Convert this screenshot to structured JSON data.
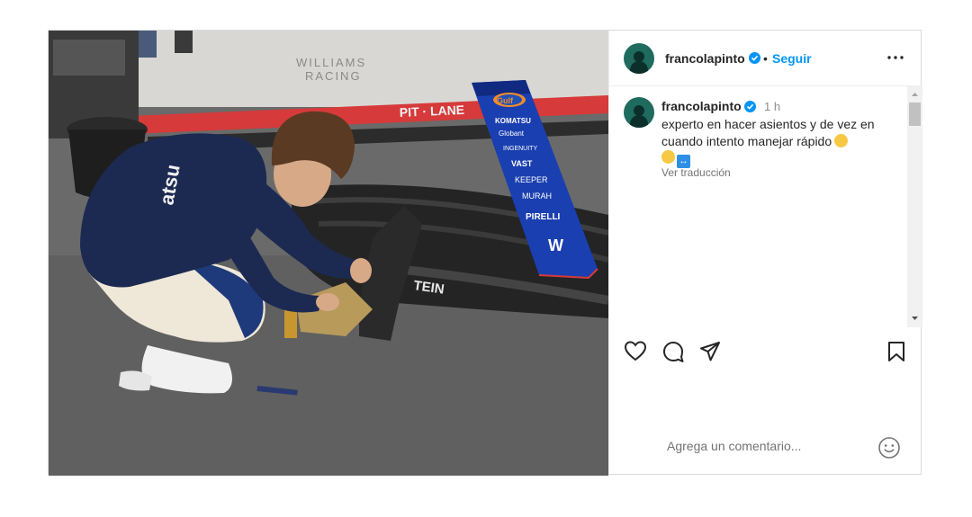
{
  "header": {
    "username": "francolapinto",
    "separator": "•",
    "follow_label": "Seguir"
  },
  "caption": {
    "username": "francolapinto",
    "time": "1 h",
    "text": "experto en hacer asientos y de vez en cuando intento manejar rápido",
    "translate_label": "Ver traducción"
  },
  "comment": {
    "placeholder": "Agrega un comentario..."
  },
  "photo": {
    "floor_text_1": "WILLIAMS",
    "floor_text_2": "RACING",
    "pitlane_text": "PIT · LANE",
    "nose_sponsors": [
      "Gulf",
      "KOMATSU",
      "Globant",
      "INGENUITY",
      "VAST",
      "KEEPER",
      "MURAH",
      "PIRELLI",
      "W"
    ],
    "wing_text": "TEIN",
    "shirt_text": "atsu"
  },
  "colors": {
    "accent": "#0095f6",
    "williams_blue": "#1a3fb0",
    "pitlane_red": "#d63a3a"
  },
  "icons": [
    "verified-icon",
    "more-options-icon",
    "heart-icon",
    "comment-icon",
    "share-icon",
    "bookmark-icon",
    "emoji-icon"
  ]
}
